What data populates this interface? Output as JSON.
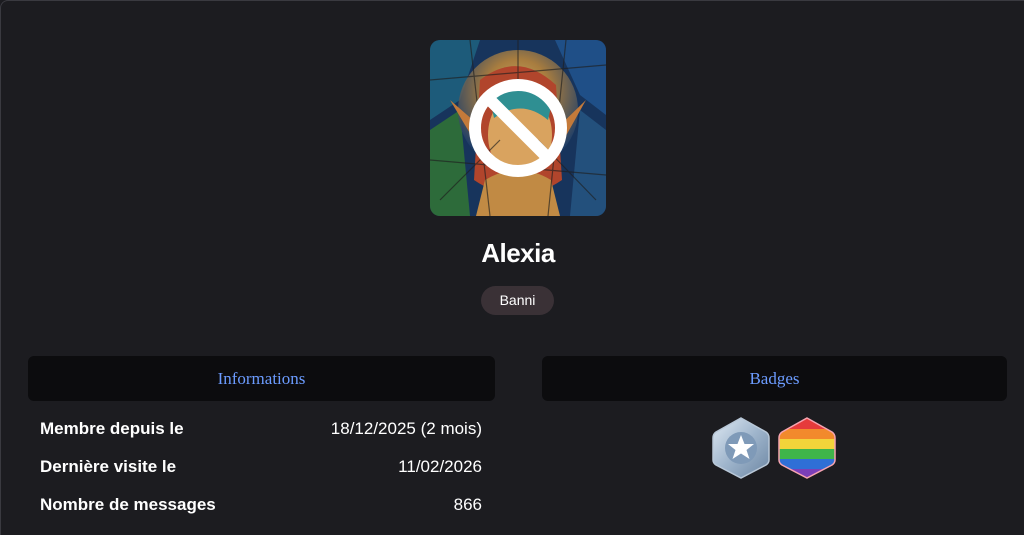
{
  "profile": {
    "username": "Alexia",
    "role": "Banni",
    "avatar_icon": "stained-glass-elf-portrait",
    "status_icon": "banned-icon"
  },
  "informations": {
    "title": "Informations",
    "rows": [
      {
        "label": "Membre depuis le",
        "value": "18/12/2025 (2 mois)"
      },
      {
        "label": "Dernière visite le",
        "value": "11/02/2026"
      },
      {
        "label": "Nombre de messages",
        "value": "866"
      }
    ]
  },
  "badges": {
    "title": "Badges",
    "items": [
      {
        "icon": "star-badge-icon"
      },
      {
        "icon": "rainbow-badge-icon"
      }
    ]
  },
  "colors": {
    "background": "#1c1c20",
    "panel_header": "#0c0c0e",
    "accent": "#6c9cff",
    "role_badge": "#3a3136"
  }
}
